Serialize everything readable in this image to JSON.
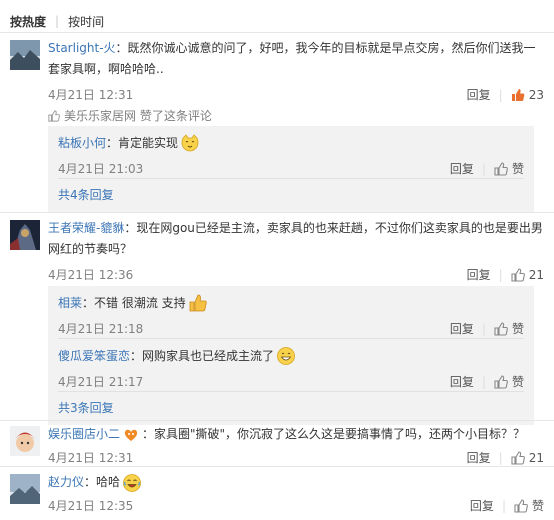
{
  "sort": {
    "by_hot": "按热度",
    "by_time": "按时间"
  },
  "colors": {
    "link": "#3b75b6",
    "liked": "#e9702f",
    "meta": "#808080",
    "reply_bg": "#f2f2f2"
  },
  "comments": [
    {
      "user": "Starlight-火",
      "text": "：既然你诚心诚意的问了，好吧，我今年的目标就是早点交房，然后你们送我一套家具啊，啊哈哈哈..",
      "time": "4月21日 12:31",
      "reply": "回复",
      "likes": "23",
      "liked": true,
      "liked_by": "美乐乐家居网 赞了这条评论",
      "replies": [
        {
          "user": "粘板小何",
          "text": "：肯定能实现",
          "emoji": "cat-emoji",
          "time": "4月21日 21:03",
          "reply": "回复",
          "like": "赞"
        }
      ],
      "more": "共4条回复"
    },
    {
      "user": "王者荣耀-貔貅",
      "text": "：现在网gou已经是主流，卖家具的也来赶趟，不过你们这卖家具的也是要出男网红的节奏吗？",
      "time": "4月21日 12:36",
      "reply": "回复",
      "likes": "21",
      "replies": [
        {
          "user": "相莱",
          "text": "：不错 很潮流 支持",
          "emoji": "thumbs-up-emoji",
          "time": "4月21日 21:18",
          "reply": "回复",
          "like": "赞"
        },
        {
          "user": "傻瓜爱笨蛋恋",
          "text": "：网购家具也已经成主流了",
          "emoji": "grin-emoji",
          "time": "4月21日 21:17",
          "reply": "回复",
          "like": "赞"
        }
      ],
      "more": "共3条回复"
    },
    {
      "user": "娱乐圈店小二",
      "text": "：家具圈\"撕破\"，你沉寂了这么久这是要搞事情了吗，还两个小目标？？",
      "time": "4月21日 12:31",
      "reply": "回复",
      "likes": "21"
    },
    {
      "user": "赵力仪",
      "text": "：哈哈",
      "time": "4月21日 12:35",
      "reply": "回复",
      "like": "赞"
    }
  ]
}
